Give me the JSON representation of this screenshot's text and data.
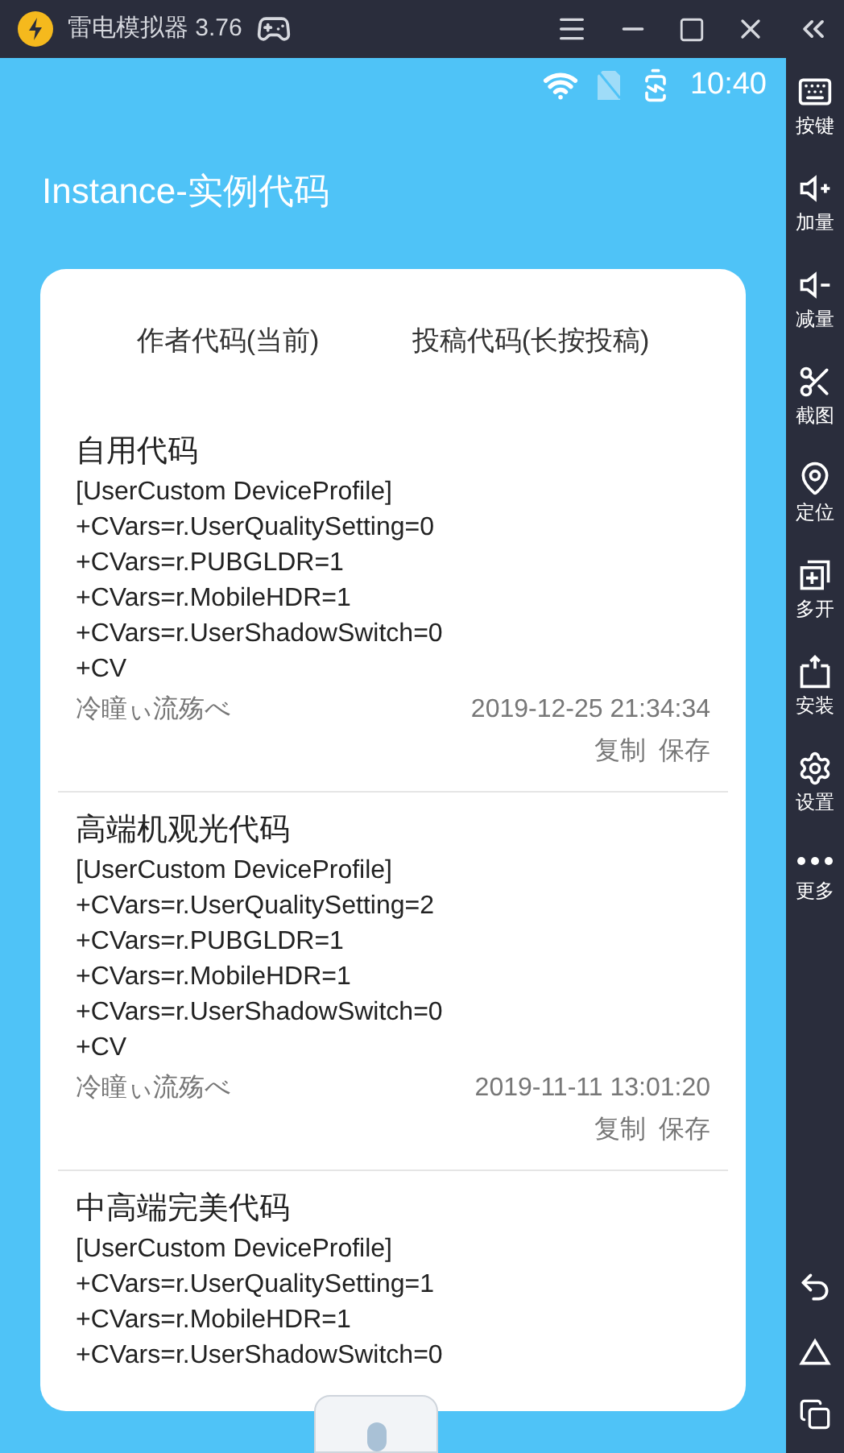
{
  "window": {
    "title": "雷电模拟器 3.76"
  },
  "status_bar": {
    "time": "10:40"
  },
  "page_title": "Instance-实例代码",
  "tabs": [
    {
      "label": "作者代码(当前)"
    },
    {
      "label": "投稿代码(长按投稿)"
    }
  ],
  "codes": [
    {
      "title": "自用代码",
      "lines": [
        "[UserCustom DeviceProfile]",
        "+CVars=r.UserQualitySetting=0",
        "+CVars=r.PUBGLDR=1",
        "+CVars=r.MobileHDR=1",
        "+CVars=r.UserShadowSwitch=0",
        "+CV"
      ],
      "author": "冷瞳ぃ流殇べ",
      "date": "2019-12-25 21:34:34",
      "actions": [
        "复制",
        "保存"
      ]
    },
    {
      "title": "高端机观光代码",
      "lines": [
        "[UserCustom DeviceProfile]",
        "+CVars=r.UserQualitySetting=2",
        "+CVars=r.PUBGLDR=1",
        "+CVars=r.MobileHDR=1",
        "+CVars=r.UserShadowSwitch=0",
        "+CV"
      ],
      "author": "冷瞳ぃ流殇べ",
      "date": "2019-11-11 13:01:20",
      "actions": [
        "复制",
        "保存"
      ]
    },
    {
      "title": "中高端完美代码",
      "lines": [
        "[UserCustom DeviceProfile]",
        "+CVars=r.UserQualitySetting=1",
        "+CVars=r.MobileHDR=1",
        "+CVars=r.UserShadowSwitch=0"
      ]
    }
  ],
  "sidebar": {
    "items": [
      {
        "kind": "keyboard",
        "label": "按键"
      },
      {
        "kind": "volume-up",
        "label": "加量"
      },
      {
        "kind": "volume-down",
        "label": "减量"
      },
      {
        "kind": "scissors",
        "label": "截图"
      },
      {
        "kind": "location",
        "label": "定位"
      },
      {
        "kind": "multi",
        "label": "多开"
      },
      {
        "kind": "apk",
        "label": "安装"
      },
      {
        "kind": "settings",
        "label": "设置"
      },
      {
        "kind": "more",
        "label": "更多"
      }
    ]
  }
}
